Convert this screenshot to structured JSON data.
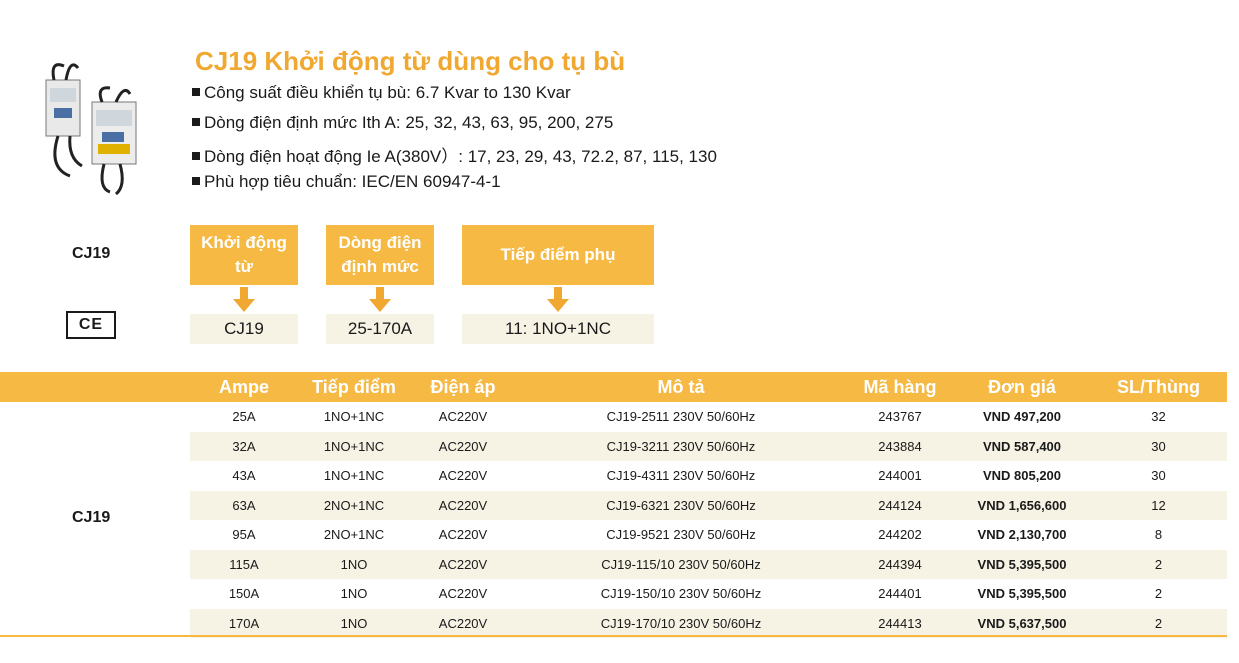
{
  "title": "CJ19 Khởi động từ dùng cho tụ bù",
  "bullets": [
    "Công suất điều khiển tụ bù: 6.7 Kvar to 130 Kvar",
    "Dòng điện định mức Ith A: 25, 32, 43, 63, 95, 200, 275",
    "Dòng điện hoạt động Ie A(380V）: 17, 23, 29, 43, 72.2, 87, 115, 130",
    "Phù hợp tiêu chuẩn: IEC/EN 60947-4-1"
  ],
  "model_label": "CJ19",
  "ce_mark": "CE",
  "selector": {
    "boxes": [
      {
        "header": "Khởi động từ",
        "value": "CJ19"
      },
      {
        "header": "Dòng điện định mức",
        "value": "25-170A"
      },
      {
        "header": "Tiếp điểm phụ",
        "value": "11: 1NO+1NC"
      }
    ]
  },
  "table": {
    "group_label": "CJ19",
    "headers": [
      "Ampe",
      "Tiếp điểm",
      "Điện áp",
      "Mô tả",
      "Mã hàng",
      "Đơn giá",
      "SL/Thùng"
    ],
    "rows": [
      [
        "25A",
        "1NO+1NC",
        "AC220V",
        "CJ19-2511 230V 50/60Hz",
        "243767",
        "VND 497,200",
        "32"
      ],
      [
        "32A",
        "1NO+1NC",
        "AC220V",
        "CJ19-3211 230V 50/60Hz",
        "243884",
        "VND 587,400",
        "30"
      ],
      [
        "43A",
        "1NO+1NC",
        "AC220V",
        "CJ19-4311 230V 50/60Hz",
        "244001",
        "VND 805,200",
        "30"
      ],
      [
        "63A",
        "2NO+1NC",
        "AC220V",
        "CJ19-6321 230V 50/60Hz",
        "244124",
        "VND 1,656,600",
        "12"
      ],
      [
        "95A",
        "2NO+1NC",
        "AC220V",
        "CJ19-9521 230V 50/60Hz",
        "244202",
        "VND 2,130,700",
        "8"
      ],
      [
        "115A",
        "1NO",
        "AC220V",
        "CJ19-115/10 230V 50/60Hz",
        "244394",
        "VND 5,395,500",
        "2"
      ],
      [
        "150A",
        "1NO",
        "AC220V",
        "CJ19-150/10 230V 50/60Hz",
        "244401",
        "VND 5,395,500",
        "2"
      ],
      [
        "170A",
        "1NO",
        "AC220V",
        "CJ19-170/10 230V 50/60Hz",
        "244413",
        "VND 5,637,500",
        "2"
      ]
    ]
  },
  "colors": {
    "accent": "#f5b944",
    "title": "#f0a830",
    "row_alt": "#f6f2e4"
  }
}
